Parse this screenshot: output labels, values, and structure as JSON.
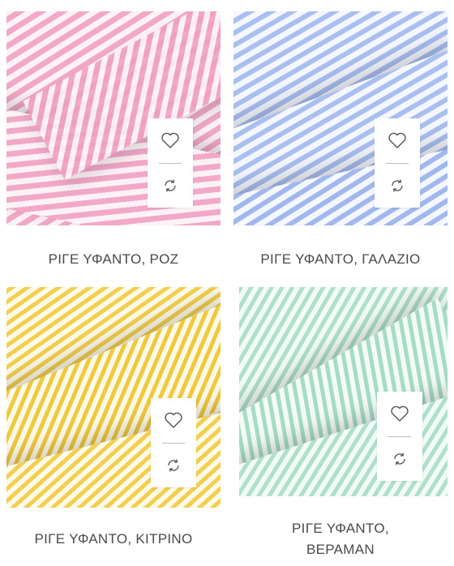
{
  "products": [
    {
      "name": "ΡΙΓΕ ΥΦΑΝΤΟ, ΡΟΖ",
      "stripe_color": "#f2a9c8",
      "base_color": "#fbe3ee",
      "wishlist_icon": "heart-icon",
      "compare_icon": "compare-arrows-icon"
    },
    {
      "name": "ΡΙΓΕ ΥΦΑΝΤΟ, ΓΑΛΑΖΙΟ",
      "stripe_color": "#a9bff0",
      "base_color": "#e6edfb",
      "wishlist_icon": "heart-icon",
      "compare_icon": "compare-arrows-icon"
    },
    {
      "name": "ΡΙΓΕ ΥΦΑΝΤΟ, ΚΙΤΡΙΝΟ",
      "stripe_color": "#f2cf4e",
      "base_color": "#fcf2cf",
      "wishlist_icon": "heart-icon",
      "compare_icon": "compare-arrows-icon"
    },
    {
      "name_line1": "ΡΙΓΕ ΥΦΑΝΤΟ,",
      "name_line2": "ΒΕΡΑΜΑΝ",
      "stripe_color": "#aee0cc",
      "base_color": "#e8f6f0",
      "wishlist_icon": "heart-icon",
      "compare_icon": "compare-arrows-icon"
    }
  ]
}
